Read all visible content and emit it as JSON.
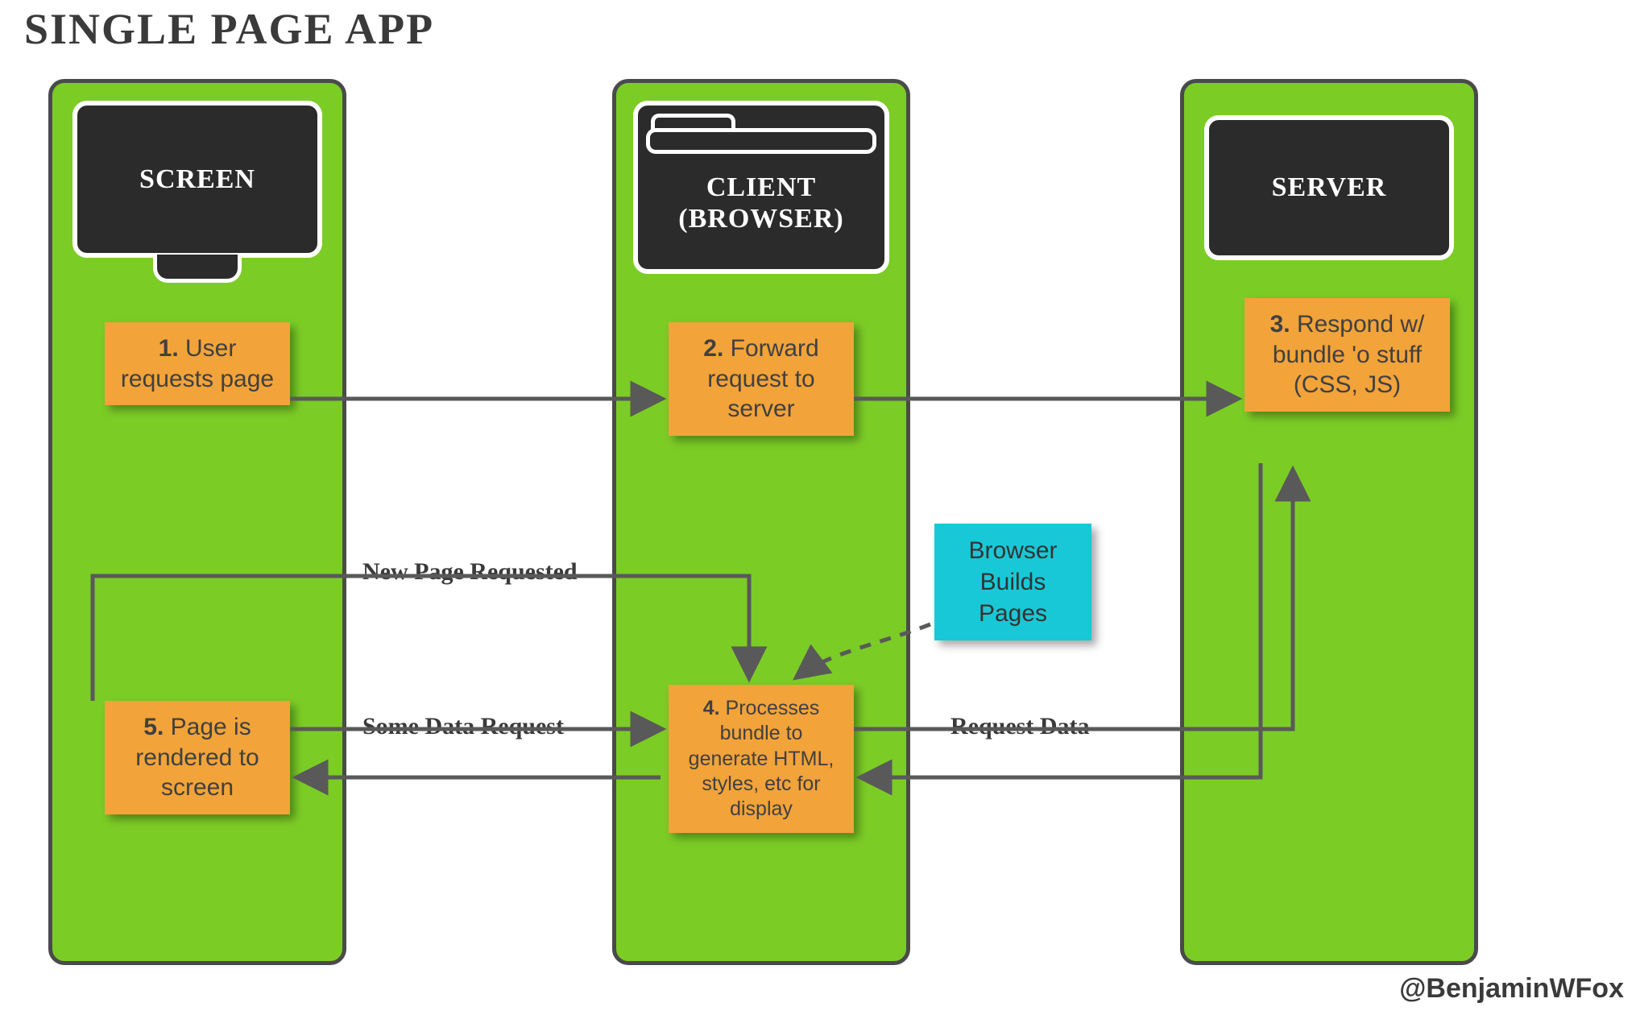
{
  "title": "SINGLE PAGE APP",
  "credit": "@BenjaminWFox",
  "columns": {
    "screen": "SCREEN",
    "client_line1": "CLIENT",
    "client_line2": "(BROWSER)",
    "server": "SERVER"
  },
  "notes": {
    "n1_num": "1.",
    "n1_text": " User requests page",
    "n2_num": "2.",
    "n2_text": " Forward request to server",
    "n3_num": "3.",
    "n3_text": " Respond w/ bundle 'o stuff (CSS, JS)",
    "n4_num": "4.",
    "n4_text": " Processes bundle to generate HTML, styles, etc for display",
    "n5_num": "5.",
    "n5_text": " Page is rendered to screen"
  },
  "cyan_note": "Browser Builds Pages",
  "edge_labels": {
    "new_page": "New Page Requested",
    "some_data": "Some Data Request",
    "req_data": "Request Data"
  },
  "colors": {
    "column": "#7ccc26",
    "sticky": "#f2a33a",
    "cyan": "#19c8d6",
    "stroke": "#595959"
  }
}
